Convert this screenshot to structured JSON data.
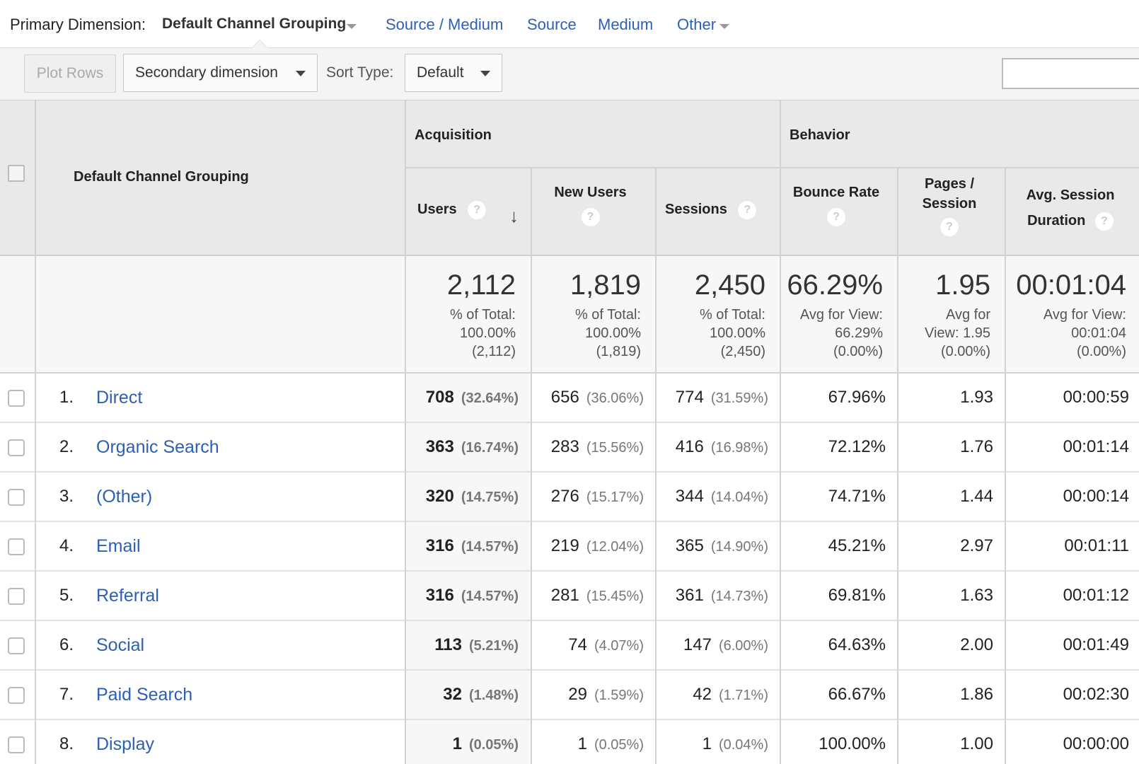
{
  "dimension_bar": {
    "label": "Primary Dimension:",
    "active": "Default Channel Grouping",
    "links": [
      "Source / Medium",
      "Source",
      "Medium",
      "Other"
    ]
  },
  "toolbar": {
    "plot_rows": "Plot Rows",
    "secondary_dimension": "Secondary dimension",
    "sort_type_label": "Sort Type:",
    "sort_type_value": "Default"
  },
  "table": {
    "dimension_header": "Default Channel Grouping",
    "groups": {
      "acquisition": "Acquisition",
      "behavior": "Behavior"
    },
    "columns": {
      "users": "Users",
      "new_users": "New Users",
      "sessions": "Sessions",
      "bounce_rate": "Bounce Rate",
      "pages_session_1": "Pages /",
      "pages_session_2": "Session",
      "avg_session_1": "Avg. Session",
      "avg_session_2": "Duration"
    },
    "help_glyph": "?",
    "sort_glyph": "↓",
    "totals": {
      "users": {
        "value": "2,112",
        "l1": "% of Total:",
        "l2": "100.00%",
        "l3": "(2,112)"
      },
      "new_users": {
        "value": "1,819",
        "l1": "% of Total:",
        "l2": "100.00%",
        "l3": "(1,819)"
      },
      "sessions": {
        "value": "2,450",
        "l1": "% of Total:",
        "l2": "100.00%",
        "l3": "(2,450)"
      },
      "bounce_rate": {
        "value": "66.29%",
        "l1": "Avg for View:",
        "l2": "66.29%",
        "l3": "(0.00%)"
      },
      "pages_session": {
        "value": "1.95",
        "l1": "Avg for",
        "l2": "View: 1.95",
        "l3": "(0.00%)"
      },
      "avg_session": {
        "value": "00:01:04",
        "l1": "Avg for View:",
        "l2": "00:01:04",
        "l3": "(0.00%)"
      }
    },
    "rows": [
      {
        "idx": "1.",
        "name": "Direct",
        "users": "708",
        "users_pct": "(32.64%)",
        "new_users": "656",
        "new_users_pct": "(36.06%)",
        "sessions": "774",
        "sessions_pct": "(31.59%)",
        "bounce": "67.96%",
        "pages": "1.93",
        "duration": "00:00:59"
      },
      {
        "idx": "2.",
        "name": "Organic Search",
        "users": "363",
        "users_pct": "(16.74%)",
        "new_users": "283",
        "new_users_pct": "(15.56%)",
        "sessions": "416",
        "sessions_pct": "(16.98%)",
        "bounce": "72.12%",
        "pages": "1.76",
        "duration": "00:01:14"
      },
      {
        "idx": "3.",
        "name": "(Other)",
        "users": "320",
        "users_pct": "(14.75%)",
        "new_users": "276",
        "new_users_pct": "(15.17%)",
        "sessions": "344",
        "sessions_pct": "(14.04%)",
        "bounce": "74.71%",
        "pages": "1.44",
        "duration": "00:00:14"
      },
      {
        "idx": "4.",
        "name": "Email",
        "users": "316",
        "users_pct": "(14.57%)",
        "new_users": "219",
        "new_users_pct": "(12.04%)",
        "sessions": "365",
        "sessions_pct": "(14.90%)",
        "bounce": "45.21%",
        "pages": "2.97",
        "duration": "00:01:11"
      },
      {
        "idx": "5.",
        "name": "Referral",
        "users": "316",
        "users_pct": "(14.57%)",
        "new_users": "281",
        "new_users_pct": "(15.45%)",
        "sessions": "361",
        "sessions_pct": "(14.73%)",
        "bounce": "69.81%",
        "pages": "1.63",
        "duration": "00:01:12"
      },
      {
        "idx": "6.",
        "name": "Social",
        "users": "113",
        "users_pct": "(5.21%)",
        "new_users": "74",
        "new_users_pct": "(4.07%)",
        "sessions": "147",
        "sessions_pct": "(6.00%)",
        "bounce": "64.63%",
        "pages": "2.00",
        "duration": "00:01:49"
      },
      {
        "idx": "7.",
        "name": "Paid Search",
        "users": "32",
        "users_pct": "(1.48%)",
        "new_users": "29",
        "new_users_pct": "(1.59%)",
        "sessions": "42",
        "sessions_pct": "(1.71%)",
        "bounce": "66.67%",
        "pages": "1.86",
        "duration": "00:02:30"
      },
      {
        "idx": "8.",
        "name": "Display",
        "users": "1",
        "users_pct": "(0.05%)",
        "new_users": "1",
        "new_users_pct": "(0.05%)",
        "sessions": "1",
        "sessions_pct": "(0.04%)",
        "bounce": "100.00%",
        "pages": "1.00",
        "duration": "00:00:00"
      }
    ]
  },
  "colors": {
    "link": "#2d5fb6",
    "header_bg": "#e9e9e9",
    "toolbar_bg": "#f4f4f4"
  }
}
